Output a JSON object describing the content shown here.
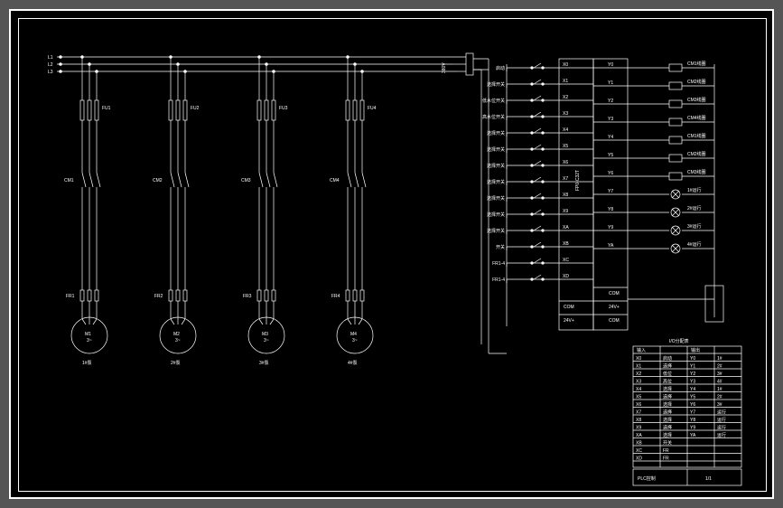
{
  "power": {
    "lines": [
      "L1",
      "L2",
      "L3"
    ],
    "voltage": "380V"
  },
  "branches": [
    {
      "fuse": "FU1",
      "contactor": "CM1",
      "relay": "FR1",
      "motor": "M1",
      "label": "1#泵"
    },
    {
      "fuse": "FU2",
      "contactor": "CM2",
      "relay": "FR2",
      "motor": "M2",
      "label": "2#泵"
    },
    {
      "fuse": "FU3",
      "contactor": "CM3",
      "relay": "FR3",
      "motor": "M3",
      "label": "3#泵"
    },
    {
      "fuse": "FU4",
      "contactor": "CM4",
      "relay": "FR4",
      "motor": "M4",
      "label": "4#泵"
    }
  ],
  "plc_box": "FP0-C32T",
  "plc_inputs": [
    {
      "sig": "启动",
      "term": "X0"
    },
    {
      "sig": "选择开关",
      "term": "X1"
    },
    {
      "sig": "低水位开关",
      "term": "X2"
    },
    {
      "sig": "高水位开关",
      "term": "X3"
    },
    {
      "sig": "选择开关",
      "term": "X4"
    },
    {
      "sig": "选择开关",
      "term": "X5"
    },
    {
      "sig": "选择开关",
      "term": "X6"
    },
    {
      "sig": "选择开关",
      "term": "X7"
    },
    {
      "sig": "选择开关",
      "term": "X8"
    },
    {
      "sig": "选择开关",
      "term": "X9"
    },
    {
      "sig": "选择开关",
      "term": "XA"
    },
    {
      "sig": "开关",
      "term": "XB"
    },
    {
      "sig": "FR1-4",
      "term": "XC"
    },
    {
      "sig": "FR1-4",
      "term": "XD"
    }
  ],
  "plc_outputs": [
    {
      "term": "Y0",
      "load": "CM1线圈"
    },
    {
      "term": "Y1",
      "load": "CM2线圈"
    },
    {
      "term": "Y2",
      "load": "CM3线圈"
    },
    {
      "term": "Y3",
      "load": "CM4线圈"
    },
    {
      "term": "Y4",
      "load": "CM1线圈"
    },
    {
      "term": "Y5",
      "load": "CM2线圈"
    },
    {
      "term": "Y6",
      "load": "CM3线圈"
    },
    {
      "term": "Y7",
      "load": "1#运行"
    },
    {
      "term": "Y8",
      "load": "2#运行"
    },
    {
      "term": "Y9",
      "load": "3#运行"
    },
    {
      "term": "YA",
      "load": "4#运行"
    }
  ],
  "plc_common": [
    "COM",
    "24V+",
    "COM",
    "24V+",
    "COM",
    "COM"
  ],
  "io_table": {
    "title": "I/O分配表",
    "headers": [
      "输入",
      "",
      "输出",
      ""
    ],
    "rows": [
      [
        "X0",
        "启动",
        "Y0",
        "1#"
      ],
      [
        "X1",
        "选择",
        "Y1",
        "2#"
      ],
      [
        "X2",
        "低位",
        "Y2",
        "3#"
      ],
      [
        "X3",
        "高位",
        "Y3",
        "4#"
      ],
      [
        "X4",
        "选择",
        "Y4",
        "1#"
      ],
      [
        "X5",
        "选择",
        "Y5",
        "2#"
      ],
      [
        "X6",
        "选择",
        "Y6",
        "3#"
      ],
      [
        "X7",
        "选择",
        "Y7",
        "运行"
      ],
      [
        "X8",
        "选择",
        "Y8",
        "运行"
      ],
      [
        "X9",
        "选择",
        "Y9",
        "运行"
      ],
      [
        "XA",
        "选择",
        "YA",
        "运行"
      ],
      [
        "XB",
        "开关",
        "",
        ""
      ],
      [
        "XC",
        "FR",
        "",
        ""
      ],
      [
        "XD",
        "FR",
        "",
        ""
      ]
    ]
  },
  "title_block": {
    "proj": "PLC控制",
    "dwg": "1/1"
  }
}
